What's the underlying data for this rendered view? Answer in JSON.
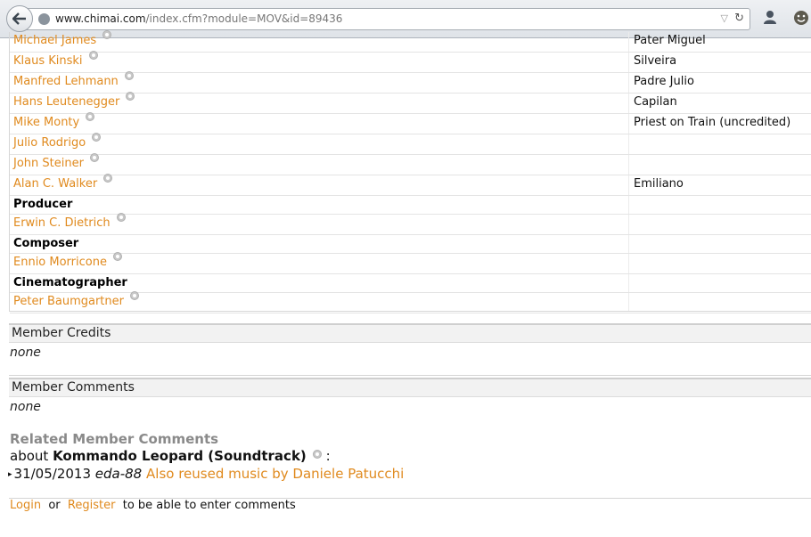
{
  "browser": {
    "url_host": "www.chimai.com",
    "url_path": "/index.cfm?module=MOV&id=89436"
  },
  "credits": {
    "rows": [
      {
        "type": "person",
        "name": "Michael James",
        "role": "Pater Miguel"
      },
      {
        "type": "person",
        "name": "Klaus Kinski",
        "role": "Silveira"
      },
      {
        "type": "person",
        "name": "Manfred Lehmann",
        "role": "Padre Julio"
      },
      {
        "type": "person",
        "name": "Hans Leutenegger",
        "role": "Capilan"
      },
      {
        "type": "person",
        "name": "Mike Monty",
        "role": "Priest on Train (uncredited)"
      },
      {
        "type": "person",
        "name": "Julio Rodrigo",
        "role": ""
      },
      {
        "type": "person",
        "name": "John Steiner",
        "role": ""
      },
      {
        "type": "person",
        "name": "Alan C. Walker",
        "role": "Emiliano"
      },
      {
        "type": "heading",
        "name": "Producer"
      },
      {
        "type": "person",
        "name": "Erwin C. Dietrich",
        "role": ""
      },
      {
        "type": "heading",
        "name": "Composer"
      },
      {
        "type": "person",
        "name": "Ennio Morricone",
        "role": ""
      },
      {
        "type": "heading",
        "name": "Cinematographer"
      },
      {
        "type": "person",
        "name": "Peter Baumgartner",
        "role": ""
      }
    ]
  },
  "member_credits": {
    "title": "Member Credits",
    "value": "none"
  },
  "member_comments": {
    "title": "Member Comments",
    "value": "none"
  },
  "related": {
    "title": "Related Member Comments",
    "about_prefix": "about",
    "about_title": "Kommando Leopard (Soundtrack)",
    "about_suffix": ":",
    "date": "31/05/2013",
    "user": "eda-88",
    "comment": "Also reused music by Daniele Patucchi"
  },
  "footer": {
    "login": "Login",
    "or": "or",
    "register": "Register",
    "suffix": "to be able to enter comments"
  }
}
